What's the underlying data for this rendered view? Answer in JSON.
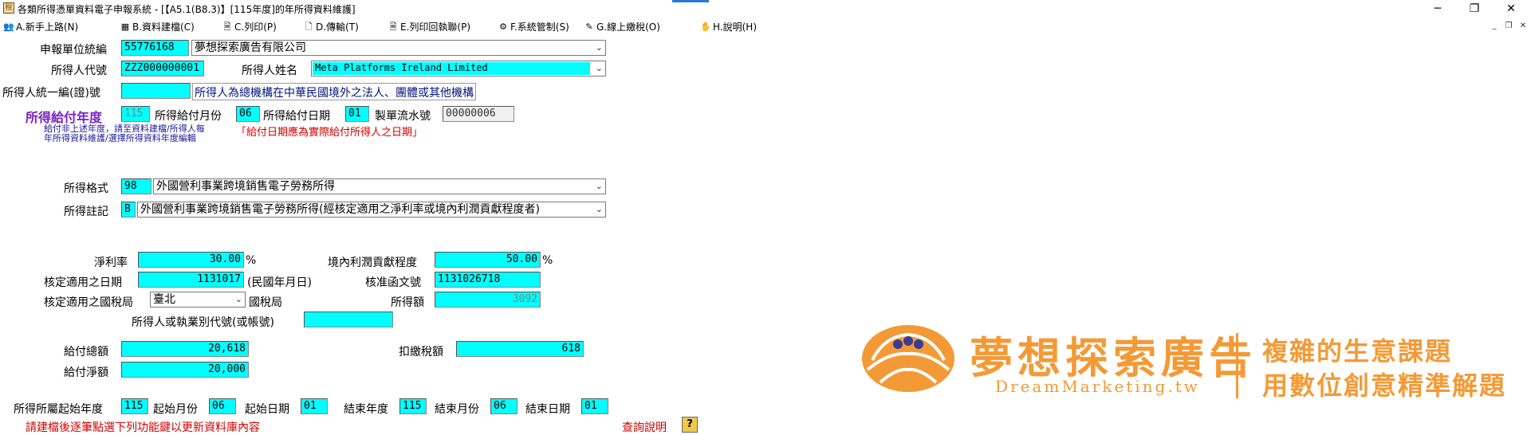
{
  "window": {
    "title": "各類所得憑單資料電子申報系統 - [【A5.1(B8.3)】[115年度]的年所得資料維護]",
    "controls": {
      "minimize": "─",
      "restore": "❐",
      "close": "✕"
    }
  },
  "menu": [
    {
      "label": "A.新手上路(N)",
      "icon": "user-guide-icon"
    },
    {
      "label": "B.資料建檔(C)",
      "icon": "data-entry-icon"
    },
    {
      "label": "C.列印(P)",
      "icon": "print-icon"
    },
    {
      "label": "D.傳輸(T)",
      "icon": "transfer-icon"
    },
    {
      "label": "E.列印回執聯(P)",
      "icon": "receipt-icon"
    },
    {
      "label": "F.系統管制(S)",
      "icon": "settings-icon"
    },
    {
      "label": "G.線上繳稅(O)",
      "icon": "online-tax-icon"
    },
    {
      "label": "H.說明(H)",
      "icon": "help-icon"
    }
  ],
  "form": {
    "unit_id_label": "申報單位統編",
    "unit_id_value": "55776168",
    "unit_name_value": "夢想探索廣告有限公司",
    "payee_code_label": "所得人代號",
    "payee_code_value": "ZZZ000000001",
    "payee_name_label": "所得人姓名",
    "payee_name_value": "Meta Platforms Ireland Limited",
    "payee_uid_label": "所得人統一編(證)號",
    "payee_uid_value": "",
    "payee_type_text": "所得人為總機構在中華民國境外之法人、團體或其他機構",
    "pay_year_label": "所得給付年度",
    "pay_year_value": "115",
    "pay_month_label": "所得給付月份",
    "pay_month_value": "06",
    "pay_date_label": "所得給付日期",
    "pay_date_value": "01",
    "serial_label": "製單流水號",
    "serial_value": "00000006",
    "note_line1": "給付非上述年度，請至資料建檔/所得人每",
    "note_line2": "年所得資料維護/選擇所得資料年度編輯",
    "note_red": "「給付日期應為實際給付所得人之日期」",
    "income_format_label": "所得格式",
    "income_format_code": "98",
    "income_format_value": "外國營利事業跨境銷售電子勞務所得",
    "income_note_label": "所得註記",
    "income_note_code": "B",
    "income_note_value": "外國營利事業跨境銷售電子勞務所得(經核定適用之淨利率或境內利潤貢獻程度者)",
    "net_rate_label": "淨利率",
    "net_rate_value": "30.00",
    "pct1": "%",
    "domestic_contrib_label": "境內利潤貢獻程度",
    "domestic_contrib_value": "50.00",
    "pct2": "%",
    "approved_date_label": "核定適用之日期",
    "approved_date_value": "1131017",
    "approved_date_hint": "(民國年月日)",
    "approval_doc_label": "核准函文號",
    "approval_doc_value": "1131026718",
    "tax_bureau_label": "核定適用之國稅局",
    "tax_bureau_value": "臺北",
    "tax_bureau_suffix": "國稅局",
    "income_amount_label": "所得額",
    "income_amount_value": "3092",
    "id_code_label": "所得人或執業別代號(或帳號)",
    "id_code_value": "",
    "gross_label": "給付總額",
    "gross_value": "20,618",
    "withholding_label": "扣繳稅額",
    "withholding_value": "618",
    "net_label": "給付淨額",
    "net_value": "20,000",
    "start_year_label": "所得所屬起始年度",
    "start_year_value": "115",
    "start_month_label": "起始月份",
    "start_month_value": "06",
    "start_date_label": "起始日期",
    "start_date_value": "01",
    "end_year_label": "結束年度",
    "end_year_value": "115",
    "end_month_label": "結束月份",
    "end_month_value": "06",
    "end_date_label": "結束日期",
    "end_date_value": "01",
    "footer_hint": "請建檔後逐筆點選下列功能鍵以更新資料庫內容",
    "query_help_label": "查詢說明",
    "query_help_icon": "?"
  },
  "logo": {
    "name_cn": "夢想探索廣告",
    "name_en": "DreamMarketing.tw",
    "slogan1": "複雜的生意課題",
    "slogan2": "用數位創意精準解題"
  },
  "colors": {
    "field_bg": "#00ffff",
    "brand_orange": "#f39a36",
    "purple_label": "#7a22c4",
    "red_note": "#d40000"
  }
}
